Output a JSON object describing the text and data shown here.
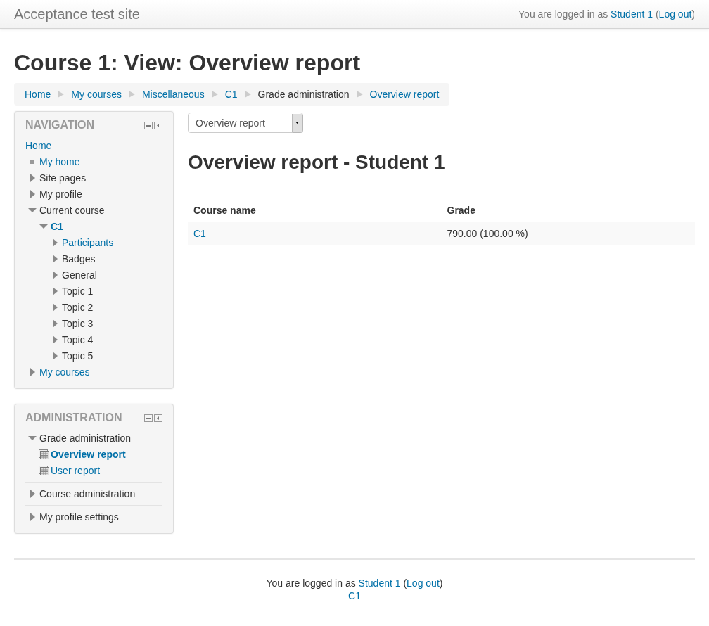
{
  "header": {
    "site_name": "Acceptance test site",
    "login_prefix": "You are logged in as",
    "user": "Student 1",
    "logout": "Log out",
    "open_paren": "(",
    "close_paren": ")"
  },
  "page_title": "Course 1: View: Overview report",
  "breadcrumb": [
    {
      "label": "Home",
      "link": true
    },
    {
      "label": "My courses",
      "link": true
    },
    {
      "label": "Miscellaneous",
      "link": true
    },
    {
      "label": "C1",
      "link": true
    },
    {
      "label": "Grade administration",
      "link": false
    },
    {
      "label": "Overview report",
      "link": true
    }
  ],
  "navigation": {
    "title": "NAVIGATION",
    "items": [
      {
        "label": "Home",
        "kind": "root",
        "link": true,
        "active": false
      },
      {
        "label": "My home",
        "kind": "leaf",
        "link": true,
        "active": false
      },
      {
        "label": "Site pages",
        "kind": "branch",
        "expanded": false,
        "link": false,
        "active": false
      },
      {
        "label": "My profile",
        "kind": "branch",
        "expanded": false,
        "link": false,
        "active": false
      },
      {
        "label": "Current course",
        "kind": "branch",
        "expanded": true,
        "link": false,
        "active": false,
        "children": [
          {
            "label": "C1",
            "kind": "branch",
            "expanded": true,
            "link": true,
            "active": true,
            "children": [
              {
                "label": "Participants",
                "kind": "branch",
                "expanded": false,
                "link": true,
                "active": false
              },
              {
                "label": "Badges",
                "kind": "branch",
                "expanded": false,
                "link": false,
                "active": false
              },
              {
                "label": "General",
                "kind": "branch",
                "expanded": false,
                "link": false,
                "active": false
              },
              {
                "label": "Topic 1",
                "kind": "branch",
                "expanded": false,
                "link": false,
                "active": false
              },
              {
                "label": "Topic 2",
                "kind": "branch",
                "expanded": false,
                "link": false,
                "active": false
              },
              {
                "label": "Topic 3",
                "kind": "branch",
                "expanded": false,
                "link": false,
                "active": false
              },
              {
                "label": "Topic 4",
                "kind": "branch",
                "expanded": false,
                "link": false,
                "active": false
              },
              {
                "label": "Topic 5",
                "kind": "branch",
                "expanded": false,
                "link": false,
                "active": false
              }
            ]
          }
        ]
      },
      {
        "label": "My courses",
        "kind": "branch",
        "expanded": false,
        "link": true,
        "active": false
      }
    ]
  },
  "administration": {
    "title": "ADMINISTRATION",
    "items": [
      {
        "label": "Grade administration",
        "kind": "branch",
        "expanded": true,
        "link": false,
        "active": false,
        "children": [
          {
            "label": "Overview report",
            "kind": "report",
            "link": true,
            "active": true
          },
          {
            "label": "User report",
            "kind": "report",
            "link": true,
            "active": false
          }
        ]
      },
      {
        "label": "Course administration",
        "kind": "branch",
        "expanded": false,
        "link": false,
        "active": false
      },
      {
        "label": "My profile settings",
        "kind": "branch",
        "expanded": false,
        "link": false,
        "active": false
      }
    ]
  },
  "report_select": {
    "value": "Overview report"
  },
  "report_heading": "Overview report - Student 1",
  "table": {
    "columns": [
      "Course name",
      "Grade"
    ],
    "rows": [
      [
        "C1",
        "790.00 (100.00 %)"
      ]
    ]
  },
  "footer": {
    "login_prefix": "You are logged in as",
    "user": "Student 1",
    "logout": "Log out",
    "open_paren": "(",
    "close_paren": ")",
    "course": "C1"
  }
}
